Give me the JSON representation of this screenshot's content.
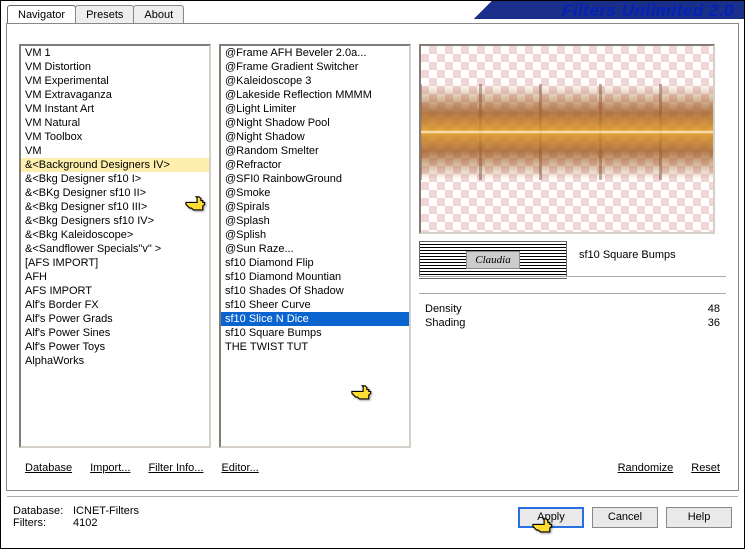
{
  "window": {
    "title": "Filters Unlimited 2.0"
  },
  "tabs": [
    {
      "label": "Navigator",
      "active": true
    },
    {
      "label": "Presets",
      "active": false
    },
    {
      "label": "About",
      "active": false
    }
  ],
  "list1": {
    "highlighted_index": 8,
    "items": [
      "VM 1",
      "VM Distortion",
      "VM Experimental",
      "VM Extravaganza",
      "VM Instant Art",
      "VM Natural",
      "VM Toolbox",
      "VM",
      "&<Background Designers IV>",
      "&<Bkg Designer sf10 I>",
      "&<BKg Designer sf10 II>",
      "&<Bkg Designer sf10 III>",
      "&<Bkg Designers sf10 IV>",
      "&<Bkg Kaleidoscope>",
      "&<Sandflower Specials\"v\" >",
      "[AFS IMPORT]",
      "AFH",
      "AFS IMPORT",
      "Alf's Border FX",
      "Alf's Power Grads",
      "Alf's Power Sines",
      "Alf's Power Toys",
      "AlphaWorks"
    ]
  },
  "list2": {
    "selected_index": 19,
    "items": [
      "@Frame AFH Beveler 2.0a...",
      "@Frame Gradient Switcher",
      "@Kaleidoscope 3",
      "@Lakeside Reflection MMMM",
      "@Light Limiter",
      "@Night Shadow Pool",
      "@Night Shadow",
      "@Random Smelter",
      "@Refractor",
      "@SFI0 RainbowGround",
      "@Smoke",
      "@Spirals",
      "@Splash",
      "@Splish",
      "@Sun Raze...",
      "sf10 Diamond Flip",
      "sf10 Diamond Mountian",
      "sf10 Shades Of Shadow",
      "sf10 Sheer Curve",
      "sf10 Slice N Dice",
      "sf10 Square Bumps",
      "THE TWIST TUT"
    ]
  },
  "preview": {
    "filter_name": "sf10 Square Bumps",
    "logo_text": "Claudia"
  },
  "params": [
    {
      "name": "Density",
      "value": 48
    },
    {
      "name": "Shading",
      "value": 36
    }
  ],
  "footer_links": {
    "database": "Database",
    "import": "Import...",
    "filter_info": "Filter Info...",
    "editor": "Editor...",
    "randomize": "Randomize",
    "reset": "Reset"
  },
  "status": {
    "db_label": "Database:",
    "db_value": "ICNET-Filters",
    "filters_label": "Filters:",
    "filters_value": "4102"
  },
  "buttons": {
    "apply": "Apply",
    "cancel": "Cancel",
    "help": "Help"
  }
}
